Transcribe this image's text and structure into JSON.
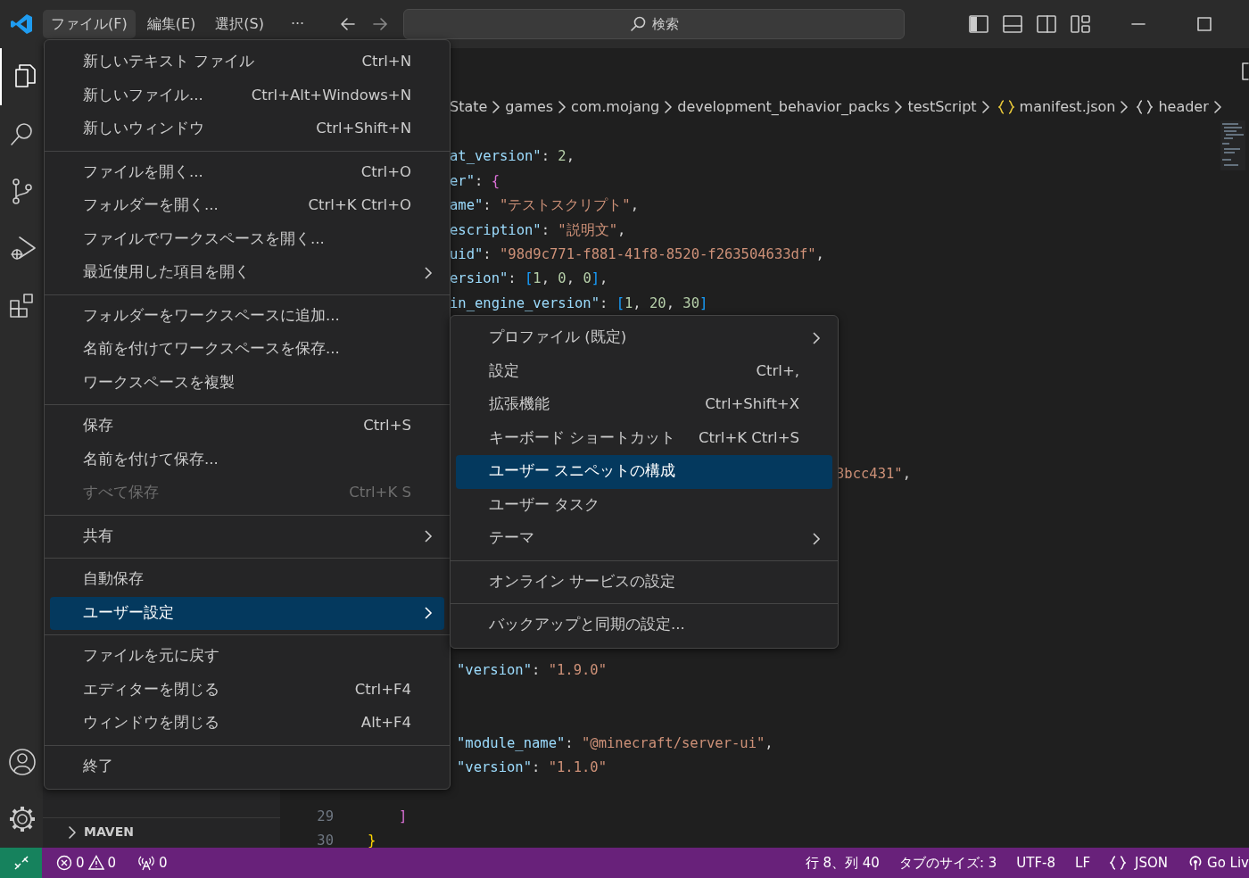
{
  "title_bar": {
    "menus": [
      {
        "label": "ファイル(F)",
        "selected": true
      },
      {
        "label": "編集(E)",
        "selected": false
      },
      {
        "label": "選択(S)",
        "selected": false
      }
    ],
    "more": "···",
    "search": {
      "placeholder": "検索"
    }
  },
  "activity_bar": {
    "items": [
      {
        "kind": "explorer",
        "selected": true
      },
      {
        "kind": "search",
        "selected": false
      },
      {
        "kind": "source-control",
        "selected": false
      },
      {
        "kind": "run-debug",
        "selected": false
      },
      {
        "kind": "extensions",
        "selected": false
      }
    ],
    "bottom": [
      {
        "kind": "account"
      },
      {
        "kind": "settings"
      }
    ]
  },
  "sidebar": {
    "section": "MAVEN"
  },
  "breadcrumb": [
    {
      "label": "State"
    },
    {
      "label": "games"
    },
    {
      "label": "com.mojang"
    },
    {
      "label": "development_behavior_packs"
    },
    {
      "label": "testScript"
    },
    {
      "label": "manifest.json",
      "kind": "file"
    },
    {
      "label": "header",
      "kind": "object"
    }
  ],
  "code_lines": [
    {
      "kind": "covered"
    },
    {
      "kind": "clipped",
      "segments": [
        {
          "kind": "key",
          "text": "at_version\""
        },
        {
          "kind": "punct",
          "text": ": "
        },
        {
          "kind": "num",
          "text": "2"
        },
        {
          "kind": "punct",
          "text": ","
        }
      ]
    },
    {
      "kind": "clipped",
      "segments": [
        {
          "kind": "key",
          "text": "er\""
        },
        {
          "kind": "punct",
          "text": ": "
        },
        {
          "kind": "bracket-pink",
          "text": "{"
        }
      ]
    },
    {
      "kind": "clipped",
      "segments": [
        {
          "kind": "key",
          "text": "ame\""
        },
        {
          "kind": "punct",
          "text": ": "
        },
        {
          "kind": "str",
          "text": "\"テストスクリプト\""
        },
        {
          "kind": "punct",
          "text": ","
        }
      ]
    },
    {
      "kind": "clipped",
      "segments": [
        {
          "kind": "key",
          "text": "escription\""
        },
        {
          "kind": "punct",
          "text": ": "
        },
        {
          "kind": "str",
          "text": "\"説明文\""
        },
        {
          "kind": "punct",
          "text": ","
        }
      ]
    },
    {
      "kind": "clipped",
      "segments": [
        {
          "kind": "key",
          "text": "uid\""
        },
        {
          "kind": "punct",
          "text": ": "
        },
        {
          "kind": "str",
          "text": "\"98d9c771-f881-41f8-8520-f263504633df\""
        },
        {
          "kind": "punct",
          "text": ","
        }
      ]
    },
    {
      "kind": "clipped",
      "segments": [
        {
          "kind": "key",
          "text": "ersion\""
        },
        {
          "kind": "punct",
          "text": ": "
        },
        {
          "kind": "bracket-blue",
          "text": "["
        },
        {
          "kind": "num",
          "text": "1"
        },
        {
          "kind": "punct",
          "text": ", "
        },
        {
          "kind": "num",
          "text": "0"
        },
        {
          "kind": "punct",
          "text": ", "
        },
        {
          "kind": "num",
          "text": "0"
        },
        {
          "kind": "bracket-blue",
          "text": "]"
        },
        {
          "kind": "punct",
          "text": ","
        }
      ]
    },
    {
      "kind": "clipped",
      "segments": [
        {
          "kind": "key",
          "text": "in_engine_version\""
        },
        {
          "kind": "punct",
          "text": ": "
        },
        {
          "kind": "bracket-blue",
          "text": "["
        },
        {
          "kind": "num",
          "text": "1"
        },
        {
          "kind": "punct",
          "text": ", "
        },
        {
          "kind": "num",
          "text": "20"
        },
        {
          "kind": "punct",
          "text": ", "
        },
        {
          "kind": "num",
          "text": "30"
        },
        {
          "kind": "bracket-blue",
          "text": "]"
        }
      ]
    },
    {
      "kind": "covered"
    },
    {
      "kind": "covered"
    },
    {
      "kind": "covered"
    },
    {
      "kind": "covered"
    },
    {
      "kind": "covered"
    },
    {
      "kind": "covered"
    },
    {
      "kind": "tail",
      "segments": [
        {
          "kind": "str",
          "text": "3bcc431\""
        },
        {
          "kind": "punct",
          "text": ","
        }
      ]
    },
    {
      "kind": "covered"
    },
    {
      "kind": "covered"
    },
    {
      "kind": "covered"
    },
    {
      "kind": "covered"
    },
    {
      "kind": "covered"
    },
    {
      "kind": "covered"
    },
    {
      "kind": "covered"
    },
    {
      "kind": "deep",
      "segments": [
        {
          "kind": "key",
          "text": "\"version\""
        },
        {
          "kind": "punct",
          "text": ": "
        },
        {
          "kind": "str",
          "text": "\"1.9.0\""
        }
      ]
    },
    {
      "kind": "covered"
    },
    {
      "kind": "covered"
    },
    {
      "kind": "deep",
      "segments": [
        {
          "kind": "key",
          "text": "\"module_name\""
        },
        {
          "kind": "punct",
          "text": ": "
        },
        {
          "kind": "str",
          "text": "\"@minecraft/server-ui\""
        },
        {
          "kind": "punct",
          "text": ","
        }
      ]
    },
    {
      "kind": "deep",
      "segments": [
        {
          "kind": "key",
          "text": "\"version\""
        },
        {
          "kind": "punct",
          "text": ": "
        },
        {
          "kind": "str",
          "text": "\"1.1.0\""
        }
      ]
    },
    {
      "kind": "covered"
    },
    {
      "kind": "nested",
      "number": "29",
      "segments": [
        {
          "kind": "bracket-pink",
          "text": "]"
        }
      ]
    },
    {
      "kind": "root",
      "number": "30",
      "segments": [
        {
          "kind": "bracket-gold",
          "text": "}"
        }
      ]
    }
  ],
  "file_menu": {
    "groups": [
      [
        {
          "label": "新しいテキスト ファイル",
          "shortcut": "Ctrl+N",
          "selected": false
        },
        {
          "label": "新しいファイル...",
          "shortcut": "Ctrl+Alt+Windows+N",
          "selected": false
        },
        {
          "label": "新しいウィンドウ",
          "shortcut": "Ctrl+Shift+N",
          "selected": false
        }
      ],
      [
        {
          "label": "ファイルを開く...",
          "shortcut": "Ctrl+O",
          "selected": false
        },
        {
          "label": "フォルダーを開く...",
          "shortcut": "Ctrl+K Ctrl+O",
          "selected": false
        },
        {
          "label": "ファイルでワークスペースを開く...",
          "selected": false
        },
        {
          "label": "最近使用した項目を開く",
          "submenu": true,
          "selected": false
        }
      ],
      [
        {
          "label": "フォルダーをワークスペースに追加...",
          "selected": false
        },
        {
          "label": "名前を付けてワークスペースを保存...",
          "selected": false
        },
        {
          "label": "ワークスペースを複製",
          "selected": false
        }
      ],
      [
        {
          "label": "保存",
          "shortcut": "Ctrl+S",
          "selected": false
        },
        {
          "label": "名前を付けて保存...",
          "selected": false
        },
        {
          "label": "すべて保存",
          "shortcut": "Ctrl+K S",
          "disabled": true,
          "selected": false
        }
      ],
      [
        {
          "label": "共有",
          "submenu": true,
          "selected": false
        }
      ],
      [
        {
          "label": "自動保存",
          "selected": false
        },
        {
          "label": "ユーザー設定",
          "submenu": true,
          "selected": true
        }
      ],
      [
        {
          "label": "ファイルを元に戻す",
          "selected": false
        },
        {
          "label": "エディターを閉じる",
          "shortcut": "Ctrl+F4",
          "selected": false
        },
        {
          "label": "ウィンドウを閉じる",
          "shortcut": "Alt+F4",
          "selected": false
        }
      ],
      [
        {
          "label": "終了",
          "selected": false
        }
      ]
    ]
  },
  "settings_submenu": {
    "groups": [
      [
        {
          "label": "プロファイル (既定)",
          "submenu": true,
          "selected": false
        },
        {
          "label": "設定",
          "shortcut": "Ctrl+,",
          "selected": false
        },
        {
          "label": "拡張機能",
          "shortcut": "Ctrl+Shift+X",
          "selected": false
        },
        {
          "label": "キーボード ショートカット",
          "shortcut": "Ctrl+K Ctrl+S",
          "selected": false
        },
        {
          "label": "ユーザー スニペットの構成",
          "selected": true
        },
        {
          "label": "ユーザー タスク",
          "selected": false
        },
        {
          "label": "テーマ",
          "submenu": true,
          "selected": false
        }
      ],
      [
        {
          "label": "オンライン サービスの設定",
          "selected": false
        }
      ],
      [
        {
          "label": "バックアップと同期の設定...",
          "selected": false
        }
      ]
    ]
  },
  "status_bar": {
    "errors": "0",
    "warnings": "0",
    "ports": "0",
    "position": "行 8、列 40",
    "tab_size": "タブのサイズ: 3",
    "encoding": "UTF-8",
    "eol": "LF",
    "language": "JSON",
    "live": "Go Liv"
  }
}
